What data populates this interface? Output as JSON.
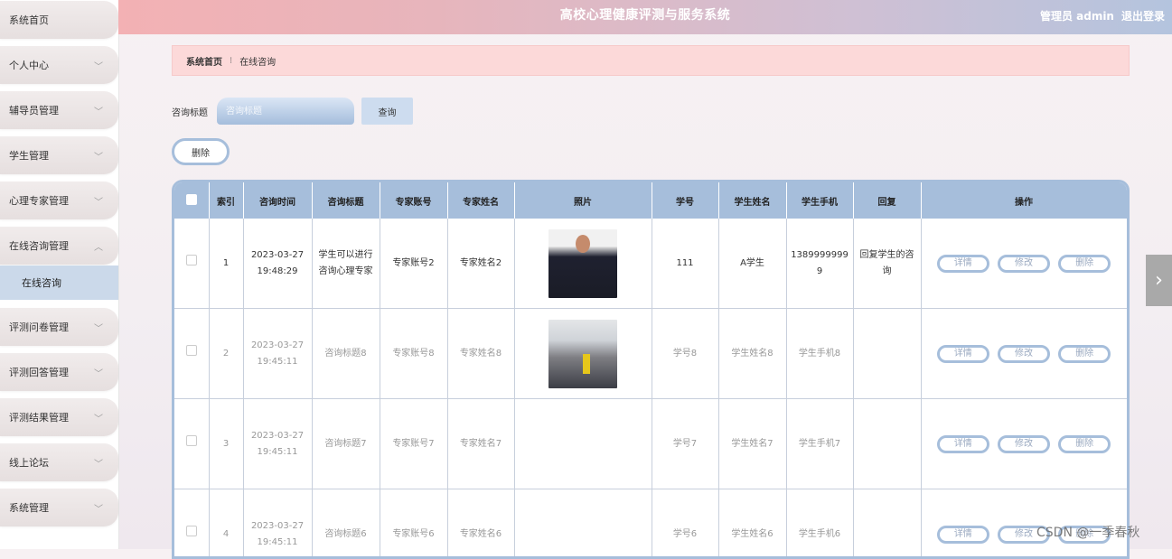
{
  "header": {
    "title": "高校心理健康评测与服务系统",
    "user_label": "管理员 admin",
    "logout_label": "退出登录"
  },
  "sidebar": {
    "items": [
      {
        "label": "系统首页",
        "has_chevron": false
      },
      {
        "label": "个人中心",
        "has_chevron": true
      },
      {
        "label": "辅导员管理",
        "has_chevron": true
      },
      {
        "label": "学生管理",
        "has_chevron": true
      },
      {
        "label": "心理专家管理",
        "has_chevron": true
      },
      {
        "label": "在线咨询管理",
        "has_chevron": true,
        "expanded": true
      },
      {
        "label": "在线咨询",
        "is_sub": true,
        "active": true
      },
      {
        "label": "评测问卷管理",
        "has_chevron": true
      },
      {
        "label": "评测回答管理",
        "has_chevron": true
      },
      {
        "label": "评测结果管理",
        "has_chevron": true
      },
      {
        "label": "线上论坛",
        "has_chevron": true
      },
      {
        "label": "系统管理",
        "has_chevron": true
      }
    ]
  },
  "breadcrumb": {
    "home": "系统首页",
    "separator": "⁝",
    "current": "在线咨询"
  },
  "search": {
    "label": "咨询标题",
    "placeholder": "咨询标题",
    "button_label": "查询"
  },
  "toolbar": {
    "delete_label": "删除"
  },
  "table": {
    "columns": [
      "索引",
      "咨询时间",
      "咨询标题",
      "专家账号",
      "专家姓名",
      "照片",
      "学号",
      "学生姓名",
      "学生手机",
      "回复",
      "操作"
    ],
    "rows": [
      {
        "index": "1",
        "time": "2023-03-27 19:48:29",
        "title": "学生可以进行咨询心理专家",
        "expert_account": "专家账号2",
        "expert_name": "专家姓名2",
        "student_id": "111",
        "student_name": "A学生",
        "phone": "13899999999",
        "reply": "回复学生的咨询"
      },
      {
        "index": "2",
        "time": "2023-03-27 19:45:11",
        "title": "咨询标题8",
        "expert_account": "专家账号8",
        "expert_name": "专家姓名8",
        "student_id": "学号8",
        "student_name": "学生姓名8",
        "phone": "学生手机8",
        "reply": ""
      },
      {
        "index": "3",
        "time": "2023-03-27 19:45:11",
        "title": "咨询标题7",
        "expert_account": "专家账号7",
        "expert_name": "专家姓名7",
        "student_id": "学号7",
        "student_name": "学生姓名7",
        "phone": "学生手机7",
        "reply": ""
      },
      {
        "index": "4",
        "time": "2023-03-27 19:45:11",
        "title": "咨询标题6",
        "expert_account": "专家账号6",
        "expert_name": "专家姓名6",
        "student_id": "学号6",
        "student_name": "学生姓名6",
        "phone": "学生手机6",
        "reply": ""
      }
    ],
    "actions": {
      "detail": "详情",
      "edit": "修改",
      "delete": "删除"
    }
  },
  "watermark": "CSDN @一季春秋",
  "colors": {
    "accent": "#a6bedb",
    "breadcrumb_bg": "#fcd9d9",
    "header_left": "#f3b1b4",
    "header_right": "#b4c4de"
  },
  "icons": {
    "chevron": "chevron-down-icon",
    "next": "chevron-right-icon"
  }
}
